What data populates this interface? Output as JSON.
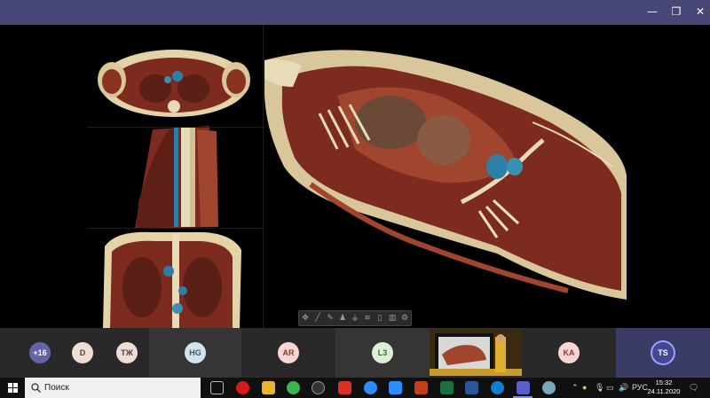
{
  "window": {
    "minimize_glyph": "—",
    "maximize_glyph": "❐",
    "close_glyph": "✕"
  },
  "toolbar": {
    "tools": [
      {
        "name": "move-tool-icon",
        "glyph": "✥"
      },
      {
        "name": "scalpel-tool-icon",
        "glyph": "╱"
      },
      {
        "name": "pen-tool-icon",
        "glyph": "✎"
      },
      {
        "name": "body-tool-icon",
        "glyph": "♟"
      },
      {
        "name": "stamp-tool-icon",
        "glyph": "⚶"
      },
      {
        "name": "layers-tool-icon",
        "glyph": "≋"
      },
      {
        "name": "table-tool-icon",
        "glyph": "▯"
      },
      {
        "name": "panel-tool-icon",
        "glyph": "▥"
      },
      {
        "name": "settings-tool-icon",
        "glyph": "⚙"
      }
    ]
  },
  "participants": [
    {
      "initials": "+16",
      "color": "#6264a7",
      "text_color": "#ffffff"
    },
    {
      "initials": "D",
      "color": "#f2ddd4",
      "text_color": "#444444"
    },
    {
      "initials": "ТЖ",
      "color": "#f2ddd4",
      "text_color": "#444444"
    },
    {
      "initials": "HG",
      "color": "#d4e4ee",
      "text_color": "#3a5666"
    },
    {
      "initials": "AR",
      "color": "#f8d7d3",
      "text_color": "#8a3a30"
    },
    {
      "initials": "L3",
      "color": "#dbefd7",
      "text_color": "#3f6a39"
    },
    {
      "initials": "KA",
      "color": "#f8d7d3",
      "text_color": "#8a3a30"
    },
    {
      "initials": "TS",
      "color": "#444791",
      "text_color": "#ffffff"
    }
  ],
  "taskbar": {
    "search_placeholder": "Поиск",
    "language": "РУС",
    "time": "15:32",
    "date": "24.11.2020"
  }
}
